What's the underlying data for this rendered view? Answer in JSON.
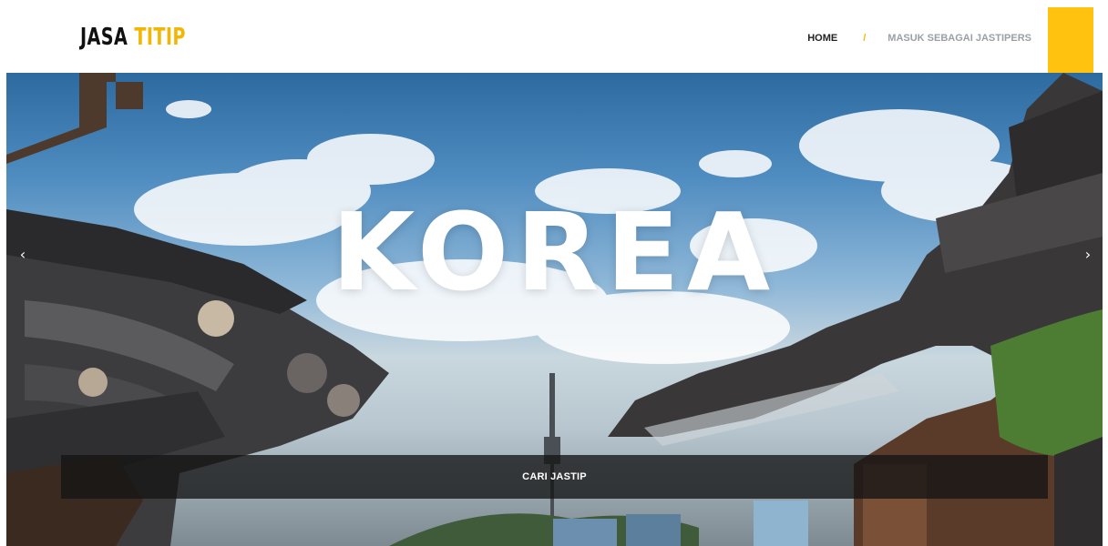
{
  "brand": {
    "part1": "JASA",
    "part2": "TITIP"
  },
  "nav": {
    "home": "HOME",
    "separator": "/",
    "login_jastiper": "MASUK SEBAGAI JASTIPERS"
  },
  "hero": {
    "title": "KOREA",
    "prev_icon": "‹",
    "next_icon": "›",
    "cta_label": "CARI JASTIP"
  },
  "colors": {
    "accent": "#ffc20e",
    "logo_accent": "#f2b705",
    "nav_muted": "#9aa0a6"
  },
  "icons": {
    "prev": "chevron-left-icon",
    "next": "chevron-right-icon"
  }
}
